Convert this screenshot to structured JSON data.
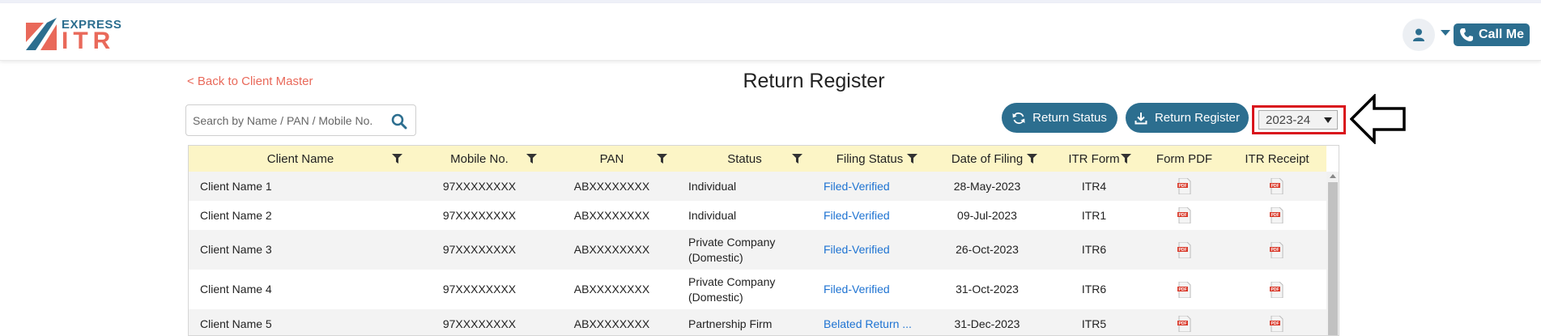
{
  "brand": {
    "top": "EXPRESS",
    "bottom": "ITR"
  },
  "header": {
    "call_label": "Call Me"
  },
  "nav": {
    "back_label": "< Back to Client Master"
  },
  "page": {
    "title": "Return Register"
  },
  "search": {
    "placeholder": "Search by Name / PAN / Mobile No."
  },
  "actions": {
    "status_label": "Return Status",
    "register_label": "Return Register"
  },
  "year_select": {
    "selected": "2023-24"
  },
  "colors": {
    "primary": "#2c6e8f",
    "accent": "#e9695a",
    "header_bg": "#fcf5c6",
    "link": "#1e73d2",
    "highlight": "#d9141c"
  },
  "table": {
    "columns": [
      "Client Name",
      "Mobile No.",
      "PAN",
      "Status",
      "Filing Status",
      "Date of Filing",
      "ITR Form",
      "Form PDF",
      "ITR Receipt"
    ],
    "rows": [
      {
        "name": "Client Name 1",
        "mobile": "97XXXXXXXX",
        "pan": "ABXXXXXXXX",
        "status": "Individual",
        "filing": "Filed-Verified",
        "date": "28-May-2023",
        "form": "ITR4"
      },
      {
        "name": "Client Name 2",
        "mobile": "97XXXXXXXX",
        "pan": "ABXXXXXXXX",
        "status": "Individual",
        "filing": "Filed-Verified",
        "date": "09-Jul-2023",
        "form": "ITR1"
      },
      {
        "name": "Client Name 3",
        "mobile": "97XXXXXXXX",
        "pan": "ABXXXXXXXX",
        "status": "Private Company (Domestic)",
        "filing": "Filed-Verified",
        "date": "26-Oct-2023",
        "form": "ITR6"
      },
      {
        "name": "Client Name 4",
        "mobile": "97XXXXXXXX",
        "pan": "ABXXXXXXXX",
        "status": "Private Company (Domestic)",
        "filing": "Filed-Verified",
        "date": "31-Oct-2023",
        "form": "ITR6"
      },
      {
        "name": "Client Name 5",
        "mobile": "97XXXXXXXX",
        "pan": "ABXXXXXXXX",
        "status": "Partnership Firm",
        "filing": "Belated Return ...",
        "date": "31-Dec-2023",
        "form": "ITR5"
      }
    ]
  }
}
